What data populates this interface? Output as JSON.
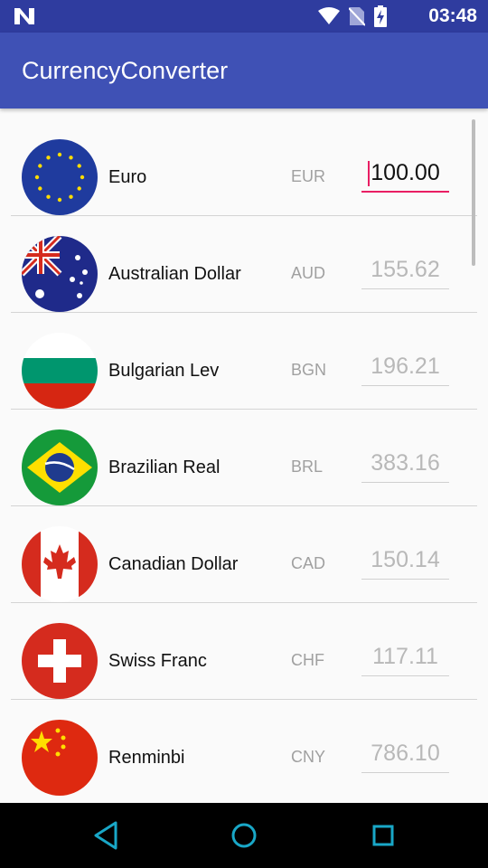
{
  "status_bar": {
    "time": "03:48",
    "icons": [
      "notification-n-icon",
      "wifi-icon",
      "no-sim-icon",
      "battery-charging-icon"
    ]
  },
  "app_bar": {
    "title": "CurrencyConverter"
  },
  "currencies": [
    {
      "name": "Euro",
      "code": "EUR",
      "amount": "100.00",
      "flag": "eu-flag-icon",
      "active": true
    },
    {
      "name": "Australian Dollar",
      "code": "AUD",
      "amount": "155.62",
      "flag": "au-flag-icon"
    },
    {
      "name": "Bulgarian Lev",
      "code": "BGN",
      "amount": "196.21",
      "flag": "bg-flag-icon"
    },
    {
      "name": "Brazilian Real",
      "code": "BRL",
      "amount": "383.16",
      "flag": "br-flag-icon"
    },
    {
      "name": "Canadian Dollar",
      "code": "CAD",
      "amount": "150.14",
      "flag": "ca-flag-icon"
    },
    {
      "name": "Swiss Franc",
      "code": "CHF",
      "amount": "117.11",
      "flag": "ch-flag-icon"
    },
    {
      "name": "Renminbi",
      "code": "CNY",
      "amount": "786.10",
      "flag": "cn-flag-icon"
    }
  ],
  "nav_bar": {
    "buttons": [
      "back-icon",
      "home-icon",
      "recents-icon"
    ]
  },
  "colors": {
    "primary": "#3f51b5",
    "primary_dark": "#2f3c9f",
    "accent": "#e91e63",
    "nav_icons": "#19a7c7"
  }
}
